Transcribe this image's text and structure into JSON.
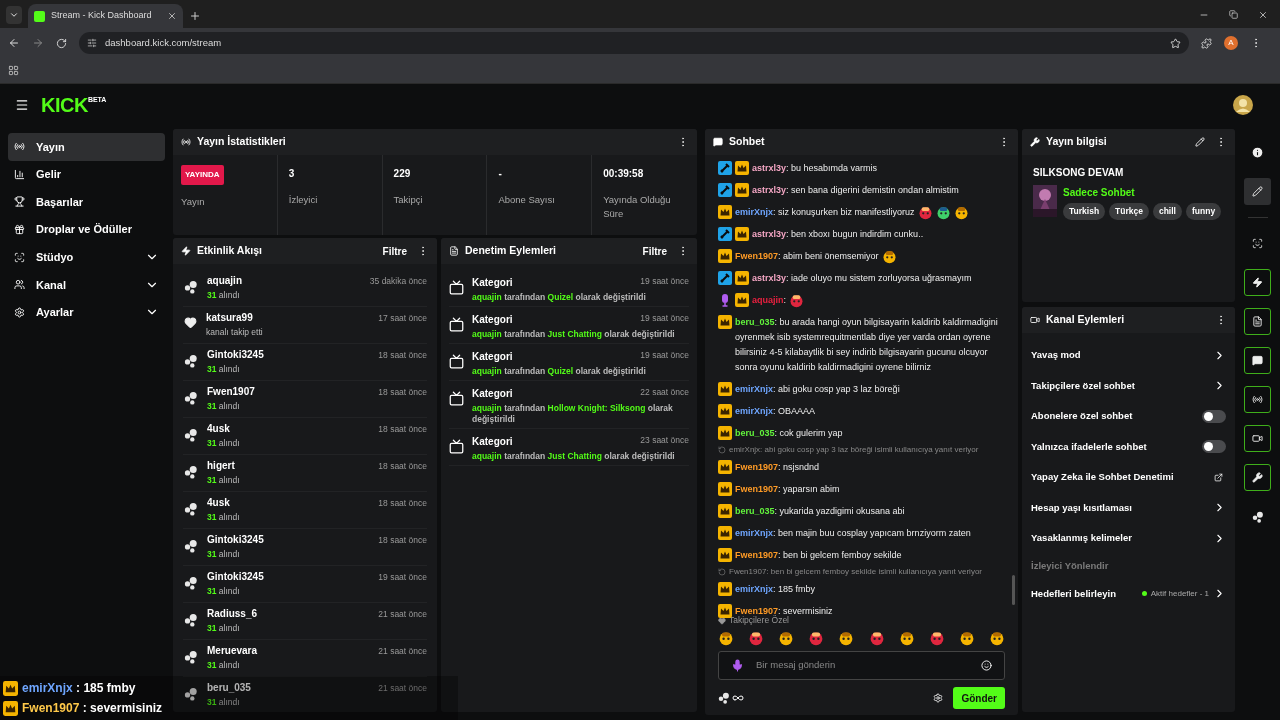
{
  "browser": {
    "tab_title": "Stream - Kick Dashboard",
    "url": "dashboard.kick.com/stream",
    "profile_initial": "A"
  },
  "header": {
    "logo": "KICK",
    "logo_badge": "BETA"
  },
  "sidebar": {
    "items": [
      {
        "kind": "stream",
        "label": "Yayın",
        "selected": true
      },
      {
        "kind": "revenue",
        "label": "Gelir",
        "selected": false
      },
      {
        "kind": "trophy",
        "label": "Başarılar",
        "selected": false
      },
      {
        "kind": "drops",
        "label": "Droplar ve Ödüller",
        "selected": false
      },
      {
        "kind": "studio",
        "label": "Stüdyo",
        "selected": false,
        "expanded": false
      },
      {
        "kind": "channel",
        "label": "Kanal",
        "selected": false,
        "expanded": false
      },
      {
        "kind": "settings",
        "label": "Ayarlar",
        "selected": false,
        "expanded": false
      }
    ]
  },
  "stats": {
    "title": "Yayın İstatistikleri",
    "live_badge": "YAYINDA",
    "live_label": "Yayın",
    "cells": [
      {
        "value": "3",
        "label": "İzleyici"
      },
      {
        "value": "229",
        "label": "Takipçi"
      },
      {
        "value": "-",
        "label": "Abone Sayısı"
      },
      {
        "value": "00:39:58",
        "label": "Yayında Olduğu Süre"
      }
    ]
  },
  "activity": {
    "title": "Etkinlik Akışı",
    "filter": "Filtre",
    "items": [
      {
        "kind": "points",
        "user": "aquajin",
        "amount": "31",
        "note": "alındı",
        "time": "35 dakika önce"
      },
      {
        "kind": "follow",
        "user": "katsura99",
        "note": "kanalı takip etti",
        "time": "17 saat önce"
      },
      {
        "kind": "points",
        "user": "Gintoki3245",
        "amount": "31",
        "note": "alındı",
        "time": "18 saat önce"
      },
      {
        "kind": "points",
        "user": "Fwen1907",
        "amount": "31",
        "note": "alındı",
        "time": "18 saat önce"
      },
      {
        "kind": "points",
        "user": "4usk",
        "amount": "31",
        "note": "alındı",
        "time": "18 saat önce"
      },
      {
        "kind": "points",
        "user": "higert",
        "amount": "31",
        "note": "alındı",
        "time": "18 saat önce"
      },
      {
        "kind": "points",
        "user": "4usk",
        "amount": "31",
        "note": "alındı",
        "time": "18 saat önce"
      },
      {
        "kind": "points",
        "user": "Gintoki3245",
        "amount": "31",
        "note": "alındı",
        "time": "18 saat önce"
      },
      {
        "kind": "points",
        "user": "Gintoki3245",
        "amount": "31",
        "note": "alındı",
        "time": "19 saat önce"
      },
      {
        "kind": "points",
        "user": "Radiuss_6",
        "amount": "31",
        "note": "alındı",
        "time": "21 saat önce"
      },
      {
        "kind": "points",
        "user": "Meruevara",
        "amount": "31",
        "note": "alındı",
        "time": "21 saat önce"
      },
      {
        "kind": "points",
        "user": "beru_035",
        "amount": "31",
        "note": "alındı",
        "time": "21 saat önce"
      }
    ]
  },
  "moderation": {
    "title": "Denetim Eylemleri",
    "filter": "Filtre",
    "items": [
      {
        "title": "Kategori",
        "time": "19 saat önce",
        "user": "aquajin",
        "by": "tarafından",
        "category": "Quizel",
        "suffix": "olarak değiştirildi"
      },
      {
        "title": "Kategori",
        "time": "19 saat önce",
        "user": "aquajin",
        "by": "tarafından",
        "category": "Just Chatting",
        "suffix": "olarak değiştirildi"
      },
      {
        "title": "Kategori",
        "time": "19 saat önce",
        "user": "aquajin",
        "by": "tarafından",
        "category": "Quizel",
        "suffix": "olarak değiştirildi"
      },
      {
        "title": "Kategori",
        "time": "22 saat önce",
        "user": "aquajin",
        "by": "tarafından",
        "category": "Hollow Knight: Silksong",
        "suffix": "olarak değiştirildi"
      },
      {
        "title": "Kategori",
        "time": "23 saat önce",
        "user": "aquajin",
        "by": "tarafından",
        "category": "Just Chatting",
        "suffix": "olarak değiştirildi"
      }
    ]
  },
  "chat": {
    "title": "Sohbet",
    "separator": ":",
    "messages": [
      {
        "kind": "message",
        "badges": [
          {
            "kind": "mod"
          },
          {
            "kind": "crown"
          }
        ],
        "user": "astrxl3y",
        "color": "#f4a6c4",
        "text": "bu hesabımda varmis"
      },
      {
        "kind": "message",
        "badges": [
          {
            "kind": "mod"
          },
          {
            "kind": "crown"
          }
        ],
        "user": "astrxl3y",
        "color": "#f4a6c4",
        "text": "sen bana digerini demistin ondan almistim"
      },
      {
        "kind": "message",
        "badges": [
          {
            "kind": "crown"
          }
        ],
        "user": "emirXnjx",
        "color": "#6fa6ff",
        "text": "siz konuşurken biz manifestliyoruz",
        "emotes": [
          {
            "kind": "picture"
          },
          {
            "kind": "picture"
          },
          {
            "kind": "picture"
          }
        ]
      },
      {
        "kind": "message",
        "badges": [
          {
            "kind": "mod"
          },
          {
            "kind": "crown"
          }
        ],
        "user": "astrxl3y",
        "color": "#f4a6c4",
        "text": "ben xboxı bugun indirdim cunku.."
      },
      {
        "kind": "message",
        "badges": [
          {
            "kind": "crown"
          }
        ],
        "user": "Fwen1907",
        "color": "#ff9b26",
        "text": "abim beni önemsemiyor",
        "emotes": [
          {
            "kind": "picture"
          }
        ]
      },
      {
        "kind": "message",
        "badges": [
          {
            "kind": "mod"
          },
          {
            "kind": "crown"
          }
        ],
        "user": "astrxl3y",
        "color": "#f4a6c4",
        "text": "iade oluyo mu sistem zorluyorsa uğrasmayım"
      },
      {
        "kind": "message",
        "badges": [
          {
            "kind": "mic"
          },
          {
            "kind": "crown"
          }
        ],
        "user": "aquajin",
        "color": "#e8203f",
        "emotes": [
          {
            "kind": "picture"
          }
        ]
      },
      {
        "kind": "message",
        "badges": [
          {
            "kind": "crown"
          }
        ],
        "user": "beru_035",
        "color": "#62f33c",
        "text": "bu arada hangi oyun bilgisayarin kaldirib kaldirmadigini oyrenmek isib systemrequitmentlab diye yer varda ordan oyrene bilirsiniz 4-5 kilabaytlik bi sey indirib bilgisayarin gucunu olcuyor sonra oyunu kaldirib kaldirmadigini oyrene bilirniz"
      },
      {
        "kind": "message",
        "badges": [
          {
            "kind": "crown"
          }
        ],
        "user": "emirXnjx",
        "color": "#6fa6ff",
        "text": "abi goku cosp yap 3 laz böreği"
      },
      {
        "kind": "message",
        "badges": [
          {
            "kind": "crown"
          }
        ],
        "user": "emirXnjx",
        "color": "#6fa6ff",
        "text": "OBAAAA"
      },
      {
        "kind": "message",
        "badges": [
          {
            "kind": "crown"
          }
        ],
        "user": "beru_035",
        "color": "#62f33c",
        "text": "cok gulerim yap"
      },
      {
        "kind": "reply",
        "text": "emirXnjx: abi goku cosp yap 3 laz böreği isimli kullanıcıya yanıt veriyor"
      },
      {
        "kind": "message",
        "badges": [
          {
            "kind": "crown"
          }
        ],
        "user": "Fwen1907",
        "color": "#ff9b26",
        "text": "nsjsndnd"
      },
      {
        "kind": "message",
        "badges": [
          {
            "kind": "crown"
          }
        ],
        "user": "Fwen1907",
        "color": "#ff9b26",
        "text": "yaparsın abim"
      },
      {
        "kind": "message",
        "badges": [
          {
            "kind": "crown"
          }
        ],
        "user": "beru_035",
        "color": "#62f33c",
        "text": "yukarida yazdigimi okusana abi"
      },
      {
        "kind": "message",
        "badges": [
          {
            "kind": "crown"
          }
        ],
        "user": "emirXnjx",
        "color": "#6fa6ff",
        "text": "ben majin buu cosplay yapıcam brnziyorm zaten"
      },
      {
        "kind": "message",
        "badges": [
          {
            "kind": "crown"
          }
        ],
        "user": "Fwen1907",
        "color": "#ff9b26",
        "text": "ben bi gelcem femboy sekilde"
      },
      {
        "kind": "reply",
        "text": "Fwen1907: ben bi gelcem femboy sekilde isimli kullanıcıya yanıt veriyor"
      },
      {
        "kind": "message",
        "badges": [
          {
            "kind": "crown"
          }
        ],
        "user": "emirXnjx",
        "color": "#6fa6ff",
        "text": "185 fmby"
      },
      {
        "kind": "message",
        "badges": [
          {
            "kind": "crown"
          }
        ],
        "user": "Fwen1907",
        "color": "#ff9b26",
        "text": "severmisiniz"
      }
    ],
    "emote_section": "Takipçilere Özel",
    "placeholder": "Bir mesaj gönderin",
    "send": "Gönder"
  },
  "stream_info": {
    "title": "Yayın bilgisi",
    "stream_title": "SILKSONG DEVAM",
    "category": "Sadece Sohbet",
    "tags": [
      "Turkish",
      "Türkçe",
      "chill",
      "funny"
    ]
  },
  "channel_actions": {
    "title": "Kanal Eylemleri",
    "items": [
      {
        "kind": "link",
        "label": "Yavaş mod"
      },
      {
        "kind": "link",
        "label": "Takipçilere özel sohbet"
      },
      {
        "kind": "toggle",
        "label": "Abonelere özel sohbet",
        "on": false
      },
      {
        "kind": "toggle",
        "label": "Yalnızca ifadelerle sohbet",
        "on": false
      },
      {
        "kind": "external",
        "label": "Yapay Zeka ile Sohbet Denetimi"
      },
      {
        "kind": "link",
        "label": "Hesap yaşı kısıtlaması"
      },
      {
        "kind": "link",
        "label": "Yasaklanmış kelimeler"
      },
      {
        "kind": "section",
        "label": "İzleyici Yönlendir"
      },
      {
        "kind": "goal",
        "label": "Hedefleri belirleyin",
        "status": "Aktif hedefler - 1"
      }
    ]
  },
  "rail": [
    {
      "kind": "info",
      "selected": false,
      "on": false
    },
    {
      "kind": "edit",
      "selected": true,
      "on": false
    },
    {
      "kind": "divider"
    },
    {
      "kind": "focus",
      "selected": false,
      "on": false
    },
    {
      "kind": "zap",
      "selected": false,
      "on": true
    },
    {
      "kind": "doc",
      "selected": false,
      "on": true
    },
    {
      "kind": "chat",
      "selected": false,
      "on": true
    },
    {
      "kind": "broadcast",
      "selected": false,
      "on": true
    },
    {
      "kind": "channel",
      "selected": false,
      "on": true
    },
    {
      "kind": "wrench",
      "selected": false,
      "on": true
    },
    {
      "kind": "points",
      "selected": false,
      "on": false
    }
  ],
  "overlay": {
    "separator": ":",
    "lines": [
      {
        "user": "emirXnjx",
        "color": "#6fa6ff",
        "text": "185 fmby"
      },
      {
        "user": "Fwen1907",
        "color": "#ffc94a",
        "text": "severmisiniz"
      }
    ]
  }
}
